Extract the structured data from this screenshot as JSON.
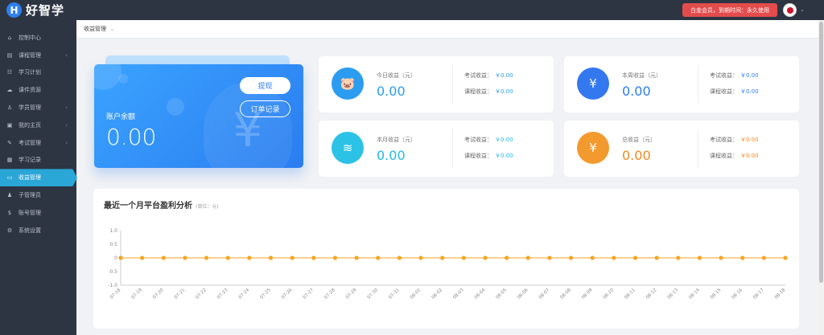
{
  "header": {
    "logo_letter": "H",
    "logo_text": "好智学",
    "membership": "白金会员，到期时间：永久使用"
  },
  "sidebar": {
    "items": [
      {
        "label": "控制中心",
        "icon": "home-icon",
        "glyph": "⌂",
        "chevron": false,
        "active": false
      },
      {
        "label": "课程管理",
        "icon": "book-icon",
        "glyph": "▤",
        "chevron": true,
        "active": false
      },
      {
        "label": "学习计划",
        "icon": "plan-icon",
        "glyph": "☷",
        "chevron": false,
        "active": false
      },
      {
        "label": "课件资源",
        "icon": "cloud-icon",
        "glyph": "☁",
        "chevron": false,
        "active": false
      },
      {
        "label": "学员管理",
        "icon": "users-icon",
        "glyph": "♙",
        "chevron": true,
        "active": false
      },
      {
        "label": "我的主页",
        "icon": "page-icon",
        "glyph": "▣",
        "chevron": true,
        "active": false
      },
      {
        "label": "考试管理",
        "icon": "exam-icon",
        "glyph": "✎",
        "chevron": true,
        "active": false
      },
      {
        "label": "学习记录",
        "icon": "record-icon",
        "glyph": "▦",
        "chevron": false,
        "active": false
      },
      {
        "label": "收益管理",
        "icon": "wallet-icon",
        "glyph": "▭",
        "chevron": false,
        "active": true
      },
      {
        "label": "子管理员",
        "icon": "admin-icon",
        "glyph": "♟",
        "chevron": false,
        "active": false
      },
      {
        "label": "账号管理",
        "icon": "dollar-icon",
        "glyph": "$",
        "chevron": false,
        "active": false
      },
      {
        "label": "系统设置",
        "icon": "gear-icon",
        "glyph": "⚙",
        "chevron": false,
        "active": false
      }
    ]
  },
  "breadcrumb": {
    "label": "收益管理"
  },
  "balance": {
    "label": "账户余额",
    "amount": "0.00",
    "withdraw": "提现",
    "orders": "订单记录"
  },
  "stats": [
    {
      "key": "today",
      "icon": "piggy-bank-icon",
      "glyph": "🐷",
      "label": "今日收益（元）",
      "amount": "0.00",
      "exam_label": "考试收益：",
      "exam_value": "￥0.00",
      "course_label": "课程收益：",
      "course_value": "￥0.00",
      "color": "#2b9cf0",
      "circle": "#2b9cf0"
    },
    {
      "key": "week",
      "icon": "wallet-card-icon",
      "glyph": "¥",
      "label": "本周收益（元）",
      "amount": "0.00",
      "exam_label": "考试收益：",
      "exam_value": "￥0.00",
      "course_label": "课程收益：",
      "course_value": "￥0.00",
      "color": "#2b7df0",
      "circle": "#3478f0"
    },
    {
      "key": "month",
      "icon": "coins-icon",
      "glyph": "≋",
      "label": "本月收益（元）",
      "amount": "0.00",
      "exam_label": "考试收益：",
      "exam_value": "￥0.00",
      "course_label": "课程收益：",
      "course_value": "￥0.00",
      "color": "#25b8e6",
      "circle": "#2cc2e6"
    },
    {
      "key": "total",
      "icon": "money-bag-icon",
      "glyph": "¥",
      "label": "总收益（元）",
      "amount": "0.00",
      "exam_label": "考试收益：",
      "exam_value": "￥0.00",
      "course_label": "课程收益：",
      "course_value": "￥0.00",
      "color": "#f08a24",
      "circle": "#f29a2e"
    }
  ],
  "chart": {
    "title": "最近一个月平台盈利分析",
    "unit": "(单位：元)"
  },
  "chart_data": {
    "type": "line",
    "categories": [
      "07-18",
      "07-19",
      "07-20",
      "07-21",
      "07-22",
      "07-23",
      "07-24",
      "07-25",
      "07-26",
      "07-27",
      "07-28",
      "07-29",
      "07-30",
      "07-31",
      "08-01",
      "08-02",
      "08-03",
      "08-04",
      "08-05",
      "08-06",
      "08-07",
      "08-08",
      "08-09",
      "08-10",
      "08-11",
      "08-12",
      "08-13",
      "08-14",
      "08-15",
      "08-16",
      "08-17",
      "08-18"
    ],
    "series": [
      {
        "values": [
          0,
          0,
          0,
          0,
          0,
          0,
          0,
          0,
          0,
          0,
          0,
          0,
          0,
          0,
          0,
          0,
          0,
          0,
          0,
          0,
          0,
          0,
          0,
          0,
          0,
          0,
          0,
          0,
          0,
          0,
          0,
          0
        ]
      }
    ],
    "ylim": [
      -1.0,
      1.0
    ],
    "yticks": [
      "1.0",
      "0.5",
      "0",
      "-0.5",
      "-1.0"
    ],
    "grid": false,
    "color": "#f5a623"
  }
}
